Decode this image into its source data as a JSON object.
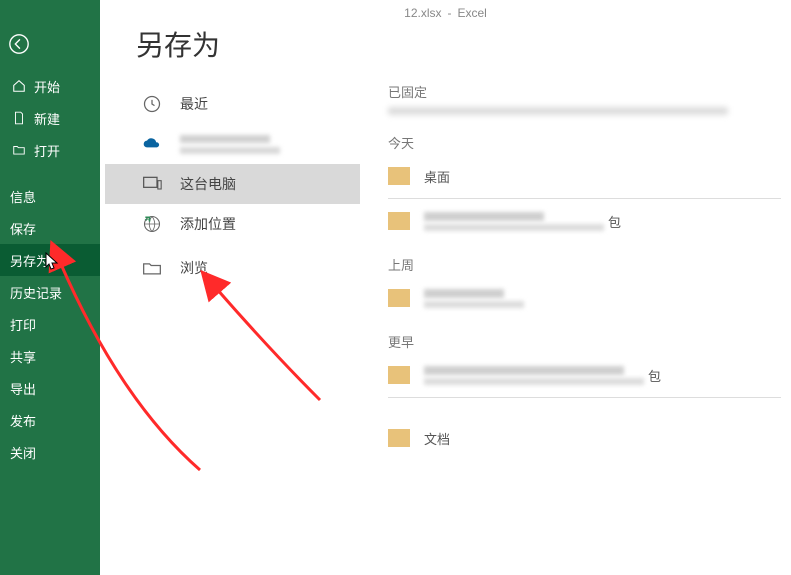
{
  "title_bar": {
    "filename": "12.xlsx",
    "separator": "-",
    "app": "Excel"
  },
  "page_title": "另存为",
  "sidebar": {
    "back": "返回",
    "top_items": [
      {
        "label": "开始",
        "icon": "home"
      },
      {
        "label": "新建",
        "icon": "new"
      },
      {
        "label": "打开",
        "icon": "open"
      }
    ],
    "bottom_items": [
      {
        "label": "信息"
      },
      {
        "label": "保存"
      },
      {
        "label": "另存为",
        "selected": true
      },
      {
        "label": "历史记录"
      },
      {
        "label": "打印"
      },
      {
        "label": "共享"
      },
      {
        "label": "导出"
      },
      {
        "label": "发布"
      },
      {
        "label": "关闭"
      }
    ]
  },
  "locations": {
    "recent": {
      "label": "最近"
    },
    "onedrive": {
      "label": "OneDrive"
    },
    "thispc": {
      "label": "这台电脑",
      "selected": true
    },
    "addplace": {
      "label": "添加位置"
    },
    "browse": {
      "label": "浏览"
    }
  },
  "right_panel": {
    "pinned": {
      "header": "已固定"
    },
    "today": {
      "header": "今天",
      "items": [
        {
          "label": "桌面"
        },
        {
          "label": "",
          "blurred": true,
          "suffix": "包"
        }
      ]
    },
    "lastweek": {
      "header": "上周",
      "items": [
        {
          "label": "",
          "blurred": true
        }
      ]
    },
    "earlier": {
      "header": "更早",
      "items": [
        {
          "label": "",
          "blurred": true,
          "suffix": "包"
        },
        {
          "label": "文档"
        }
      ]
    }
  }
}
